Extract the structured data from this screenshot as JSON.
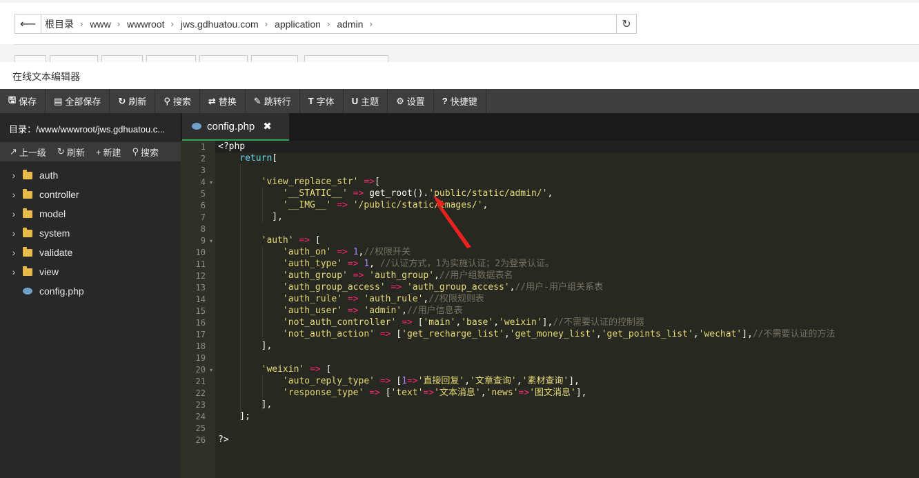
{
  "breadcrumbs": [
    "根目录",
    "www",
    "wwwroot",
    "jws.gdhuatou.com",
    "application",
    "admin"
  ],
  "window_title": "在线文本编辑器",
  "toolbar": [
    {
      "icon": "save-icon",
      "glyph": "🖫",
      "label": "保存"
    },
    {
      "icon": "save-all-icon",
      "glyph": "▤",
      "label": "全部保存"
    },
    {
      "icon": "refresh-icon",
      "glyph": "↻",
      "label": "刷新"
    },
    {
      "icon": "search-icon",
      "glyph": "⚲",
      "label": "搜索"
    },
    {
      "icon": "replace-icon",
      "glyph": "⇄",
      "label": "替换"
    },
    {
      "icon": "goto-line-icon",
      "glyph": "✎",
      "label": "跳转行"
    },
    {
      "icon": "font-icon",
      "glyph": "T",
      "label": "字体"
    },
    {
      "icon": "theme-icon",
      "glyph": "U",
      "label": "主题"
    },
    {
      "icon": "settings-icon",
      "glyph": "⚙",
      "label": "设置"
    },
    {
      "icon": "shortcuts-icon",
      "glyph": "?",
      "label": "快捷键"
    }
  ],
  "sidebar": {
    "dir_label": "目录：/www/wwwroot/jws.gdhuatou.c...",
    "actions": [
      {
        "icon": "up-level-icon",
        "glyph": "↗",
        "label": "上一级"
      },
      {
        "icon": "refresh-icon",
        "glyph": "↻",
        "label": "刷新"
      },
      {
        "icon": "new-icon",
        "glyph": "+",
        "label": "新建"
      },
      {
        "icon": "search-icon",
        "glyph": "⚲",
        "label": "搜索"
      }
    ],
    "items": [
      {
        "type": "folder",
        "label": "auth"
      },
      {
        "type": "folder",
        "label": "controller"
      },
      {
        "type": "folder",
        "label": "model"
      },
      {
        "type": "folder",
        "label": "system"
      },
      {
        "type": "folder",
        "label": "validate"
      },
      {
        "type": "folder",
        "label": "view"
      },
      {
        "type": "file",
        "label": "config.php"
      }
    ]
  },
  "tab": {
    "label": "config.php",
    "close": "✖"
  },
  "colors": {
    "accent": "#2fa84f",
    "toolbar": "#3e3e3e",
    "editor_bg": "#272822"
  },
  "code_lines": [
    [
      [
        "t",
        "<?php"
      ]
    ],
    [
      [
        "t",
        "    "
      ],
      [
        "k",
        "return"
      ],
      [
        "t",
        "["
      ]
    ],
    [],
    [
      [
        "t",
        "        "
      ],
      [
        "s",
        "'view_replace_str'"
      ],
      [
        "t",
        " "
      ],
      [
        "o",
        "=>"
      ],
      [
        "t",
        "["
      ]
    ],
    [
      [
        "t",
        "            "
      ],
      [
        "s",
        "'__STATIC__'"
      ],
      [
        "t",
        " "
      ],
      [
        "o",
        "=>"
      ],
      [
        "t",
        " get_root()."
      ],
      [
        "s",
        "'public/static/admin/'"
      ],
      [
        "t",
        ","
      ]
    ],
    [
      [
        "t",
        "            "
      ],
      [
        "s",
        "'__IMG__'"
      ],
      [
        "t",
        " "
      ],
      [
        "o",
        "=>"
      ],
      [
        "t",
        " "
      ],
      [
        "s",
        "'/public/static/images/'"
      ],
      [
        "t",
        ","
      ]
    ],
    [
      [
        "t",
        "          ],"
      ]
    ],
    [],
    [
      [
        "t",
        "        "
      ],
      [
        "s",
        "'auth'"
      ],
      [
        "t",
        " "
      ],
      [
        "o",
        "=>"
      ],
      [
        "t",
        " ["
      ]
    ],
    [
      [
        "t",
        "            "
      ],
      [
        "s",
        "'auth_on'"
      ],
      [
        "t",
        " "
      ],
      [
        "o",
        "=>"
      ],
      [
        "t",
        " "
      ],
      [
        "n",
        "1"
      ],
      [
        "t",
        ","
      ],
      [
        "c",
        "//权限开关"
      ]
    ],
    [
      [
        "t",
        "            "
      ],
      [
        "s",
        "'auth_type'"
      ],
      [
        "t",
        " "
      ],
      [
        "o",
        "=>"
      ],
      [
        "t",
        " "
      ],
      [
        "n",
        "1"
      ],
      [
        "t",
        ", "
      ],
      [
        "c",
        "//认证方式，1为实施认证；2为登录认证。"
      ]
    ],
    [
      [
        "t",
        "            "
      ],
      [
        "s",
        "'auth_group'"
      ],
      [
        "t",
        " "
      ],
      [
        "o",
        "=>"
      ],
      [
        "t",
        " "
      ],
      [
        "s",
        "'auth_group'"
      ],
      [
        "t",
        ","
      ],
      [
        "c",
        "//用户组数据表名"
      ]
    ],
    [
      [
        "t",
        "            "
      ],
      [
        "s",
        "'auth_group_access'"
      ],
      [
        "t",
        " "
      ],
      [
        "o",
        "=>"
      ],
      [
        "t",
        " "
      ],
      [
        "s",
        "'auth_group_access'"
      ],
      [
        "t",
        ","
      ],
      [
        "c",
        "//用户-用户组关系表"
      ]
    ],
    [
      [
        "t",
        "            "
      ],
      [
        "s",
        "'auth_rule'"
      ],
      [
        "t",
        " "
      ],
      [
        "o",
        "=>"
      ],
      [
        "t",
        " "
      ],
      [
        "s",
        "'auth_rule'"
      ],
      [
        "t",
        ","
      ],
      [
        "c",
        "//权限规则表"
      ]
    ],
    [
      [
        "t",
        "            "
      ],
      [
        "s",
        "'auth_user'"
      ],
      [
        "t",
        " "
      ],
      [
        "o",
        "=>"
      ],
      [
        "t",
        " "
      ],
      [
        "s",
        "'admin'"
      ],
      [
        "t",
        ","
      ],
      [
        "c",
        "//用户信息表"
      ]
    ],
    [
      [
        "t",
        "            "
      ],
      [
        "s",
        "'not_auth_controller'"
      ],
      [
        "t",
        " "
      ],
      [
        "o",
        "=>"
      ],
      [
        "t",
        " ["
      ],
      [
        "s",
        "'main'"
      ],
      [
        "t",
        ","
      ],
      [
        "s",
        "'base'"
      ],
      [
        "t",
        ","
      ],
      [
        "s",
        "'weixin'"
      ],
      [
        "t",
        "],"
      ],
      [
        "c",
        "//不需要认证的控制器"
      ]
    ],
    [
      [
        "t",
        "            "
      ],
      [
        "s",
        "'not_auth_action'"
      ],
      [
        "t",
        " "
      ],
      [
        "o",
        "=>"
      ],
      [
        "t",
        " ["
      ],
      [
        "s",
        "'get_recharge_list'"
      ],
      [
        "t",
        ","
      ],
      [
        "s",
        "'get_money_list'"
      ],
      [
        "t",
        ","
      ],
      [
        "s",
        "'get_points_list'"
      ],
      [
        "t",
        ","
      ],
      [
        "s",
        "'wechat'"
      ],
      [
        "t",
        "],"
      ],
      [
        "c",
        "//不需要认证的方法"
      ]
    ],
    [
      [
        "t",
        "        ],"
      ]
    ],
    [],
    [
      [
        "t",
        "        "
      ],
      [
        "s",
        "'weixin'"
      ],
      [
        "t",
        " "
      ],
      [
        "o",
        "=>"
      ],
      [
        "t",
        " ["
      ]
    ],
    [
      [
        "t",
        "            "
      ],
      [
        "s",
        "'auto_reply_type'"
      ],
      [
        "t",
        " "
      ],
      [
        "o",
        "=>"
      ],
      [
        "t",
        " ["
      ],
      [
        "n",
        "1"
      ],
      [
        "o",
        "=>"
      ],
      [
        "s",
        "'直接回复'"
      ],
      [
        "t",
        ","
      ],
      [
        "s",
        "'文章查询'"
      ],
      [
        "t",
        ","
      ],
      [
        "s",
        "'素材查询'"
      ],
      [
        "t",
        "],"
      ]
    ],
    [
      [
        "t",
        "            "
      ],
      [
        "s",
        "'response_type'"
      ],
      [
        "t",
        " "
      ],
      [
        "o",
        "=>"
      ],
      [
        "t",
        " ["
      ],
      [
        "s",
        "'text'"
      ],
      [
        "o",
        "=>"
      ],
      [
        "s",
        "'文本消息'"
      ],
      [
        "t",
        ","
      ],
      [
        "s",
        "'news'"
      ],
      [
        "o",
        "=>"
      ],
      [
        "s",
        "'图文消息'"
      ],
      [
        "t",
        "],"
      ]
    ],
    [
      [
        "t",
        "        ],"
      ]
    ],
    [
      [
        "t",
        "    ];"
      ]
    ],
    [],
    [
      [
        "t",
        "?>"
      ]
    ]
  ],
  "fold_lines": [
    4,
    9,
    20
  ],
  "line_numbers": [
    "1",
    "2",
    "3",
    "4",
    "5",
    "6",
    "7",
    "8",
    "9",
    "10",
    "11",
    "12",
    "13",
    "14",
    "15",
    "16",
    "17",
    "18",
    "19",
    "20",
    "21",
    "22",
    "23",
    "24",
    "25",
    "26"
  ]
}
